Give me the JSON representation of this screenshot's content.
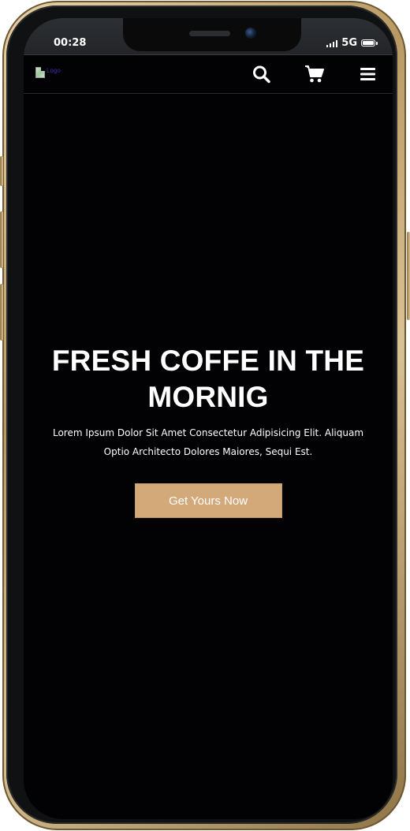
{
  "status_bar": {
    "time": "00:28",
    "network": "5G"
  },
  "header": {
    "logo_alt": "Logo",
    "icons": {
      "search": "search-icon",
      "cart": "cart-icon",
      "menu": "hamburger-menu-icon"
    }
  },
  "hero": {
    "title": "FRESH COFFE IN THE MORNIG",
    "description": "Lorem Ipsum Dolor Sit Amet Consectetur Adipisicing Elit. Aliquam Optio Architecto Dolores Maiores, Sequi Est.",
    "cta_label": "Get Yours Now"
  },
  "colors": {
    "background": "#020204",
    "accent": "#d3a97a",
    "text": "#ffffff",
    "frame": "#c2a36c"
  }
}
